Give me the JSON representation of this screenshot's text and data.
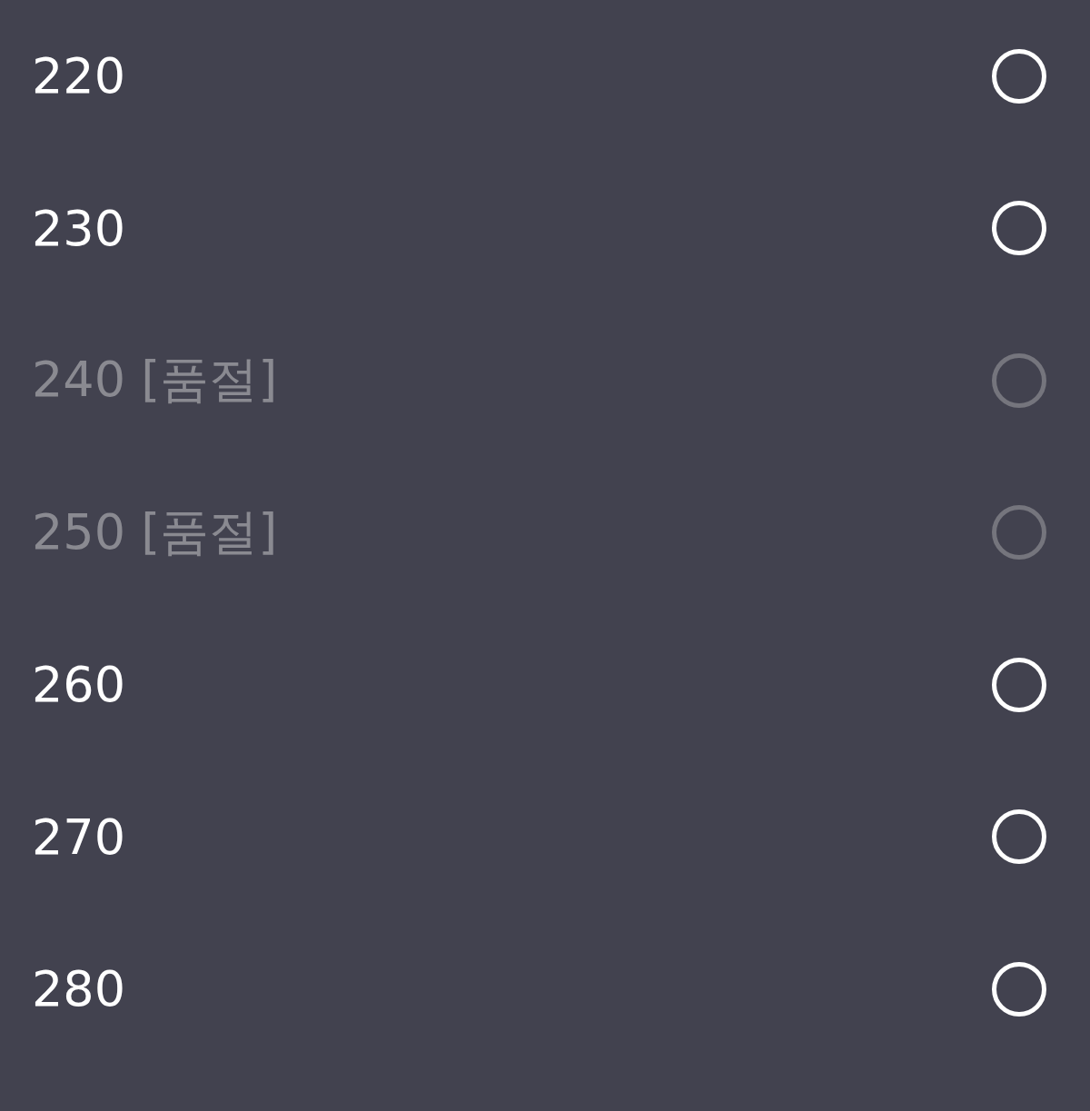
{
  "options": [
    {
      "label": "220",
      "selected": false,
      "disabled": false
    },
    {
      "label": "230",
      "selected": false,
      "disabled": false
    },
    {
      "label": "240 [품절]",
      "selected": false,
      "disabled": true
    },
    {
      "label": "250 [품절]",
      "selected": false,
      "disabled": true
    },
    {
      "label": "260",
      "selected": false,
      "disabled": false
    },
    {
      "label": "270",
      "selected": false,
      "disabled": false
    },
    {
      "label": "280",
      "selected": false,
      "disabled": false
    }
  ]
}
